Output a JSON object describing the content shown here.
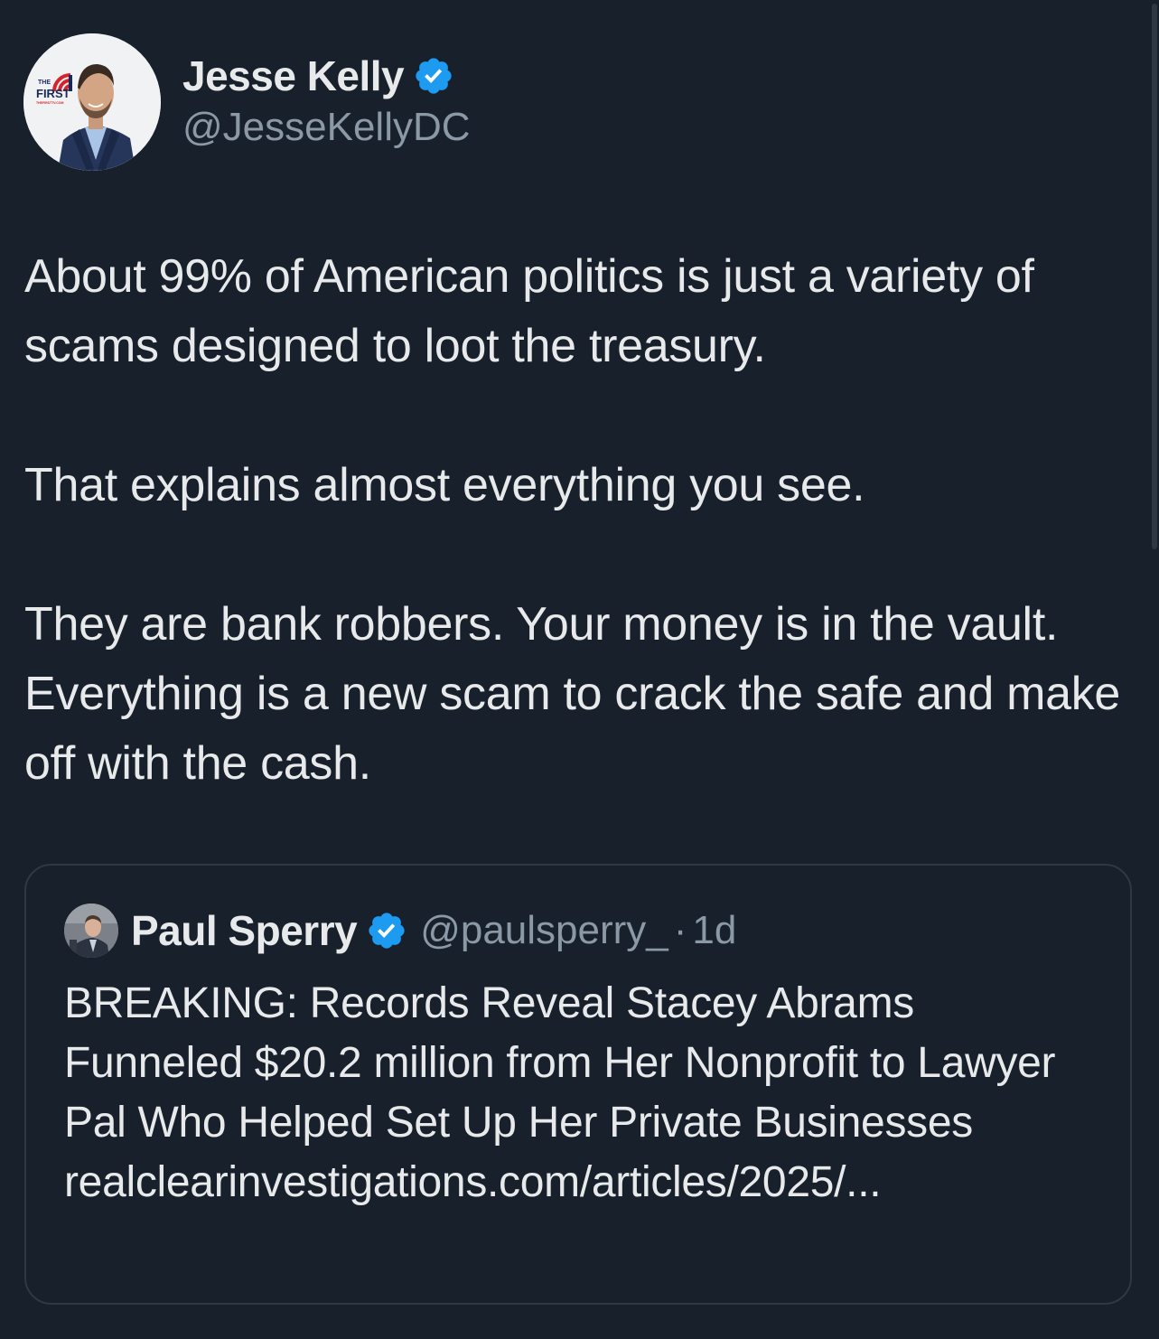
{
  "author": {
    "display_name": "Jesse Kelly",
    "handle": "@JesseKellyDC",
    "avatar_badge_small": "THE",
    "avatar_badge_large": "FIRST",
    "avatar_badge_url": "THEFIRSTTV.COM"
  },
  "tweet": {
    "paragraphs": [
      "About 99% of American politics is just a variety of scams designed to loot the treasury.",
      "That explains almost everything you see.",
      "They are bank robbers. Your money is in the vault. Everything is a new scam to crack the safe and make off with the cash."
    ]
  },
  "quoted": {
    "display_name": "Paul Sperry",
    "handle": "@paulsperry_",
    "separator": "·",
    "time": "1d",
    "text": "BREAKING: Records Reveal Stacey Abrams Funneled $20.2 million from Her Nonprofit to Lawyer Pal Who Helped Set Up Her Private Businesses",
    "link": "realclearinvestigations.com/articles/2025/..."
  },
  "colors": {
    "background": "#17202b",
    "text": "#e7e9ea",
    "secondary_text": "#8b98a5",
    "verified_blue": "#1d9bf0",
    "border": "#2f3943"
  },
  "icons": {
    "verified": "verified-badge-icon"
  }
}
